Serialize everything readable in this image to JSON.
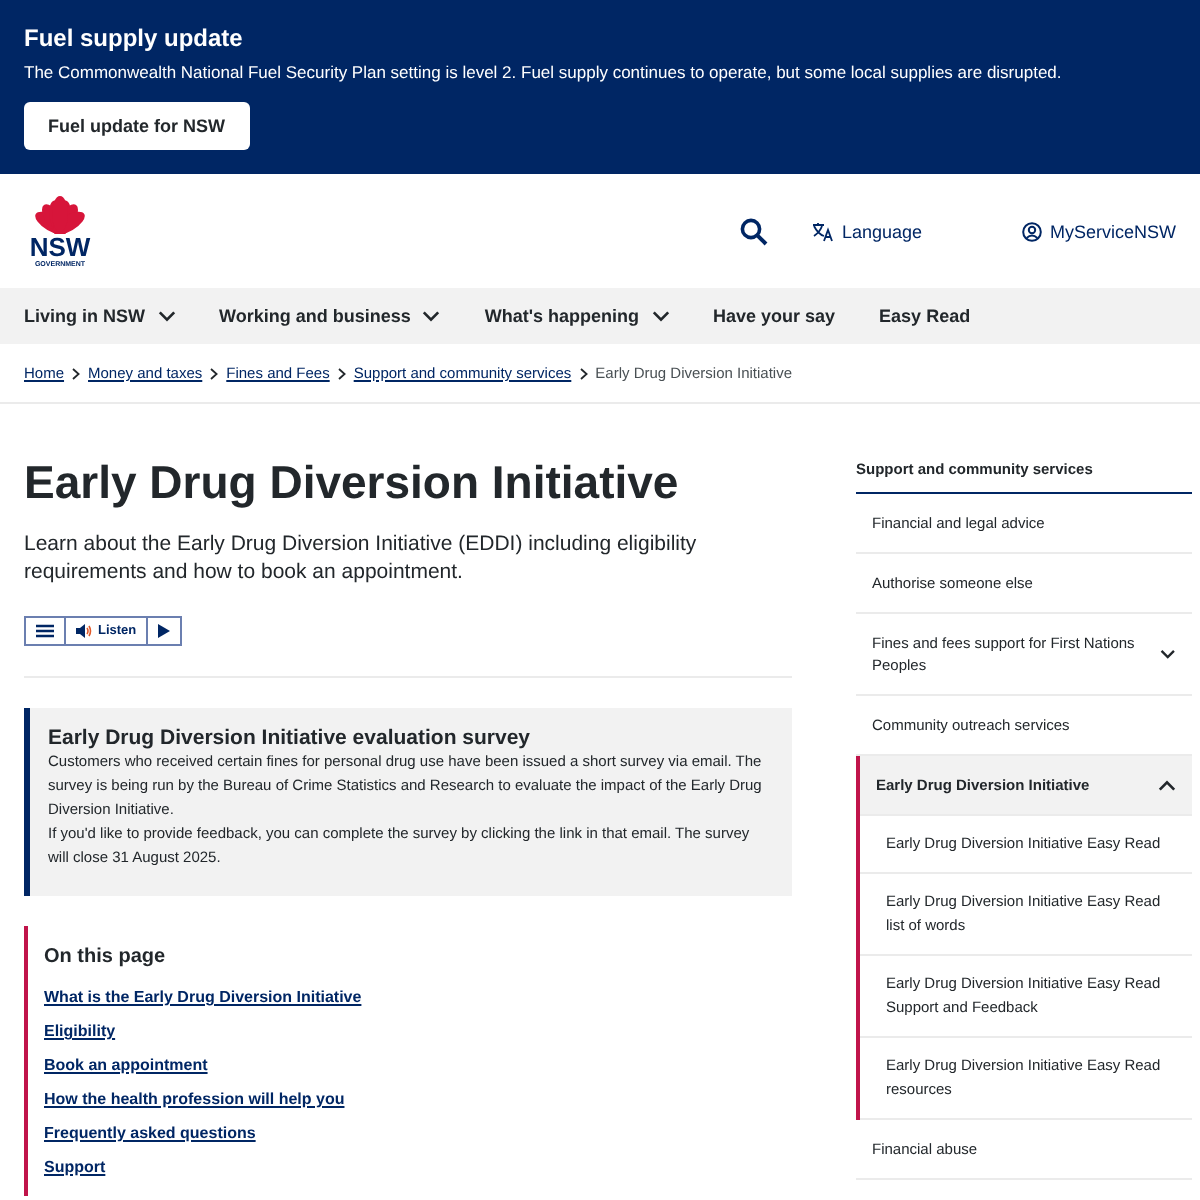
{
  "alert": {
    "title": "Fuel supply update",
    "text": "The Commonwealth National Fuel Security Plan setting is level 2. Fuel supply continues to operate, but some local supplies are disrupted.",
    "button": "Fuel update for NSW"
  },
  "header": {
    "logo": {
      "name": "NSW",
      "sub": "GOVERNMENT"
    },
    "language": "Language",
    "account": "MyServiceNSW"
  },
  "nav": [
    {
      "label": "Living in NSW",
      "dropdown": true
    },
    {
      "label": "Working and business",
      "dropdown": true
    },
    {
      "label": "What's happening",
      "dropdown": true
    },
    {
      "label": "Have your say",
      "dropdown": false
    },
    {
      "label": "Easy Read",
      "dropdown": false
    }
  ],
  "breadcrumb": [
    {
      "label": "Home",
      "link": true
    },
    {
      "label": "Money and taxes",
      "link": true
    },
    {
      "label": "Fines and Fees",
      "link": true
    },
    {
      "label": "Support and community services",
      "link": true
    },
    {
      "label": "Early Drug Diversion Initiative",
      "link": false
    }
  ],
  "page": {
    "title": "Early Drug Diversion Initiative",
    "intro": "Learn about the Early Drug Diversion Initiative (EDDI) including eligibility requirements and how to book an appointment.",
    "listen": "Listen"
  },
  "notice": {
    "title": "Early Drug Diversion Initiative evaluation survey",
    "paragraphs": [
      "Customers who received certain fines for personal drug use have been issued a short survey via email. The survey is being run by the Bureau of Crime Statistics and Research to evaluate the impact of the Early Drug Diversion Initiative.",
      "If you'd like to provide feedback, you can complete the survey by clicking the link in that email. The survey will close 31 August 2025."
    ]
  },
  "on_this_page": {
    "title": "On this page",
    "links": [
      "What is the Early Drug Diversion Initiative",
      "Eligibility",
      "Book an appointment",
      "How the health profession will help you",
      "Frequently asked questions",
      "Support"
    ]
  },
  "sidebar": {
    "title": "Support and community services",
    "items": [
      {
        "label": "Financial and legal advice",
        "selected": false
      },
      {
        "label": "Authorise someone else",
        "selected": false
      },
      {
        "label": "Fines and fees support for First Nations Peoples",
        "selected": false,
        "expanded": false
      },
      {
        "label": "Community outreach services",
        "selected": false
      },
      {
        "label": "Early Drug Diversion Initiative",
        "selected": true,
        "expanded": true,
        "children": [
          {
            "label": "Early Drug Diversion Initiative Easy Read"
          },
          {
            "label": "Early Drug Diversion Initiative Easy Read list of words"
          },
          {
            "label": "Early Drug Diversion Initiative Easy Read Support and Feedback"
          },
          {
            "label": "Early Drug Diversion Initiative Easy Read resources"
          }
        ]
      },
      {
        "label": "Financial abuse",
        "selected": false
      }
    ]
  }
}
